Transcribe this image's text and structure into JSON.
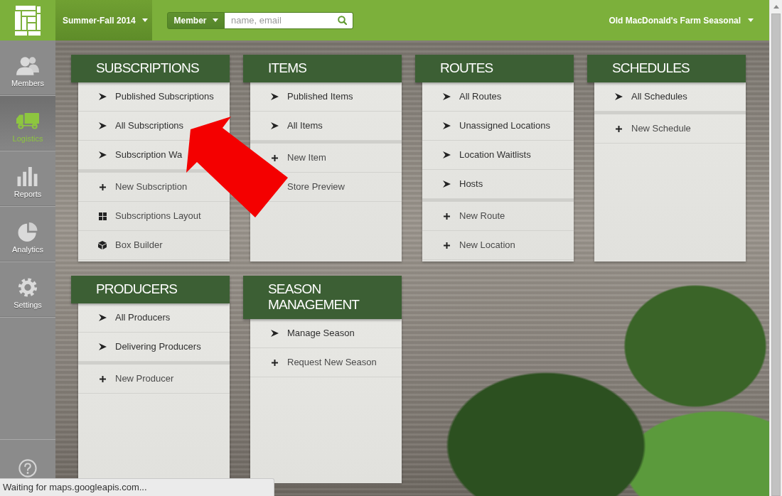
{
  "top_bar": {
    "season": "Summer-Fall 2014",
    "search": {
      "scope": "Member",
      "placeholder": "name, email"
    },
    "account": "Old MacDonald's Farm Seasonal"
  },
  "sidebar": {
    "items": [
      {
        "label": "Members",
        "kind": "people",
        "selected": false
      },
      {
        "label": "Logistics",
        "kind": "truck",
        "selected": true
      },
      {
        "label": "Reports",
        "kind": "bars",
        "selected": false
      },
      {
        "label": "Analytics",
        "kind": "pie",
        "selected": false
      },
      {
        "label": "Settings",
        "kind": "gear",
        "selected": false
      }
    ]
  },
  "panels": [
    {
      "title": "SUBSCRIPTIONS",
      "groups": [
        [
          {
            "label": "Published Subscriptions",
            "kind": "link"
          },
          {
            "label": "All Subscriptions",
            "kind": "link"
          },
          {
            "label": "Subscription Wa",
            "kind": "link"
          }
        ],
        [
          {
            "label": "New Subscription",
            "kind": "new"
          },
          {
            "label": "Subscriptions Layout",
            "kind": "layout"
          },
          {
            "label": "Box Builder",
            "kind": "builder"
          }
        ]
      ]
    },
    {
      "title": "ITEMS",
      "groups": [
        [
          {
            "label": "Published Items",
            "kind": "link"
          },
          {
            "label": "All Items",
            "kind": "link"
          }
        ],
        [
          {
            "label": "New Item",
            "kind": "new"
          },
          {
            "label": "Store Preview",
            "kind": "preview"
          }
        ]
      ]
    },
    {
      "title": "ROUTES",
      "groups": [
        [
          {
            "label": "All Routes",
            "kind": "link"
          },
          {
            "label": "Unassigned Locations",
            "kind": "link"
          },
          {
            "label": "Location Waitlists",
            "kind": "link"
          },
          {
            "label": "Hosts",
            "kind": "link"
          }
        ],
        [
          {
            "label": "New Route",
            "kind": "new"
          },
          {
            "label": "New Location",
            "kind": "new"
          }
        ]
      ]
    },
    {
      "title": "SCHEDULES",
      "groups": [
        [
          {
            "label": "All Schedules",
            "kind": "link"
          }
        ],
        [
          {
            "label": "New Schedule",
            "kind": "new"
          }
        ]
      ]
    },
    {
      "title": "PRODUCERS",
      "groups": [
        [
          {
            "label": "All Producers",
            "kind": "link"
          },
          {
            "label": "Delivering Producers",
            "kind": "link"
          }
        ],
        [
          {
            "label": "New Producer",
            "kind": "new"
          }
        ]
      ]
    },
    {
      "title": "SEASON MANAGEMENT",
      "groups": [
        [
          {
            "label": "Manage Season",
            "kind": "link"
          },
          {
            "label": "Request New Season",
            "kind": "new"
          }
        ]
      ]
    }
  ],
  "status_bar": "Waiting for maps.googleapis.com..."
}
